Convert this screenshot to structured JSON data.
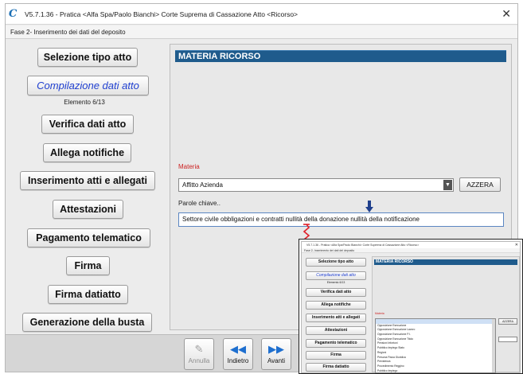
{
  "window": {
    "title": "V5.7.1.36 - Pratica <Alfa Spa/Paolo Bianchi>   Corte Suprema di Cassazione  Atto <Ricorso>",
    "close": "✕",
    "phase": "Fase 2- Inserimento dei dati del deposito"
  },
  "sidebar": {
    "items": [
      {
        "label": "Selezione tipo atto"
      },
      {
        "label": "Compilazione dati atto",
        "active": true,
        "sub": "Elemento 6/13"
      },
      {
        "label": "Verifica dati atto"
      },
      {
        "label": "Allega notifiche"
      },
      {
        "label": "Inserimento atti e allegati"
      },
      {
        "label": "Attestazioni"
      },
      {
        "label": "Pagamento telematico"
      },
      {
        "label": "Firma"
      },
      {
        "label": "Firma datiatto"
      },
      {
        "label": "Generazione della busta"
      }
    ]
  },
  "main": {
    "section_title": "MATERIA RICORSO",
    "materia_label": "Materia",
    "materia_value": "Affitto Azienda",
    "azzera_label": "AZZERA",
    "keywords_label": "Parole chiave..",
    "keywords_value": "Settore civile obbligazioni e contratti nullità della donazione nullità della notificazione"
  },
  "footer": {
    "buttons": [
      {
        "label": "Annulla",
        "icon": "pencil-icon",
        "enabled": false
      },
      {
        "label": "Indietro",
        "icon": "rewind-icon",
        "enabled": true
      },
      {
        "label": "Avanti",
        "icon": "fast-forward-icon",
        "enabled": true
      }
    ]
  },
  "inset": {
    "title": "V5.7.1.36 - Pratica <Alfa Spa/Paolo Bianchi>   Corte Suprema di Cassazione  Atto <Ricorso>",
    "phase": "Fase 2- Inserimento dei dati del deposito",
    "items": [
      "Selezione tipo atto",
      "Compilazione dati atto",
      "Verifica dati atto",
      "Allega notifiche",
      "Inserimento atti e allegati",
      "Attestazioni",
      "Pagamento telematico",
      "Firma",
      "Firma datiatto"
    ],
    "sub": "Elemento 6/13",
    "section_title": "MATERIA RICORSO",
    "materia_label": "Materia",
    "azzera_label": "AZZERA",
    "dropdown_options": [
      "",
      "Opposizione Esecuzione",
      "Opposizione Esecuzione Lavoro",
      "Opposizione Esecuzione P.I.",
      "Opposizione Esecuzione Titolo",
      "Pensioni Infortuni",
      "Pubblico Impiego Stato",
      "Regioni",
      "Persona Fisica Giuridica",
      "Previdenza",
      "Procedimento Reggino",
      "Pubblico Impiego"
    ]
  },
  "colors": {
    "header_bg": "#1f5b8c",
    "active_link": "#1f3fd0",
    "required_label": "#cc2222",
    "nav_icon": "#1e6fcf"
  }
}
